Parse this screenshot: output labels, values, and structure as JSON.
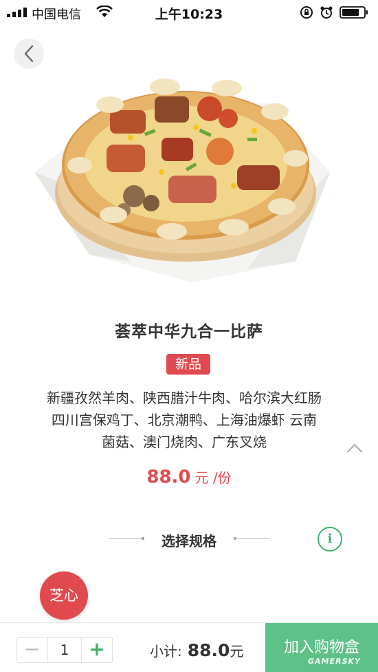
{
  "status_bar": {
    "carrier": "中国电信",
    "time": "上午10:23"
  },
  "product": {
    "title": "荟萃中华九合一比萨",
    "badge": "新品",
    "description_lines": [
      "新疆孜然羊肉、陕西腊汁牛肉、哈尔滨大红肠",
      "四川宫保鸡丁、北京潮鸭、上海油爆虾 云南",
      "菌菇、澳门烧肉、广东叉烧"
    ],
    "price": "88.0",
    "price_unit": "元 /份"
  },
  "spec": {
    "title": "选择规格"
  },
  "promo_badge": "芝心",
  "cart": {
    "minus": "−",
    "quantity": "1",
    "plus": "+",
    "subtotal_label": "小计:",
    "subtotal_value": "88.0",
    "subtotal_unit": "元",
    "add_button": "加入购物盒"
  },
  "watermark": "GAMERSKY",
  "colors": {
    "accent_red": "#e04a4f",
    "accent_green": "#3db26b",
    "cart_button": "#5ec188"
  },
  "icons": [
    "signal-icon",
    "wifi-icon",
    "lock-rotation-icon",
    "alarm-icon",
    "battery-icon",
    "back-chevron-icon",
    "chevron-up-icon",
    "info-icon"
  ]
}
